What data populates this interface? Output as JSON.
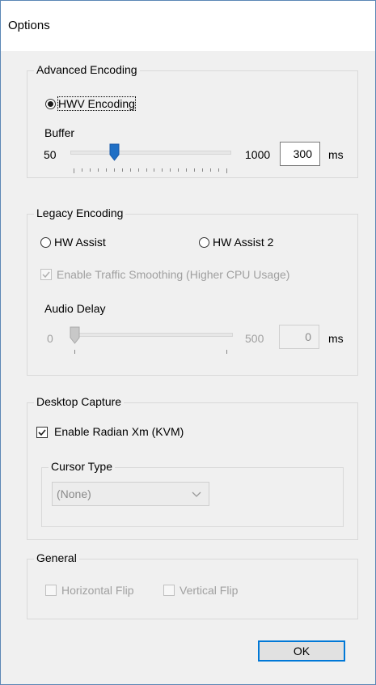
{
  "window": {
    "title": "Options"
  },
  "advanced": {
    "legend": "Advanced Encoding",
    "hwv_label": "HWV Encoding",
    "buffer_label": "Buffer",
    "min_label": "50",
    "max_label": "1000",
    "value": "300",
    "unit": "ms",
    "slider_fraction": 0.26
  },
  "legacy": {
    "legend": "Legacy Encoding",
    "hw_assist_label": "HW Assist",
    "hw_assist2_label": "HW Assist 2",
    "smoothing_label": "Enable Traffic Smoothing (Higher CPU Usage)",
    "audio_delay_label": "Audio Delay",
    "min_label": "0",
    "max_label": "500",
    "value": "0",
    "unit": "ms",
    "slider_fraction": 0.0
  },
  "desktop": {
    "legend": "Desktop Capture",
    "radian_label": "Enable Radian Xm (KVM)",
    "cursor_legend": "Cursor Type",
    "cursor_value": "(None)"
  },
  "general": {
    "legend": "General",
    "hflip_label": "Horizontal Flip",
    "vflip_label": "Vertical Flip"
  },
  "buttons": {
    "ok_label": "OK"
  },
  "colors": {
    "accent": "#0078d7",
    "slider_thumb": "#1f6fc5",
    "border": "#5b87b5"
  }
}
